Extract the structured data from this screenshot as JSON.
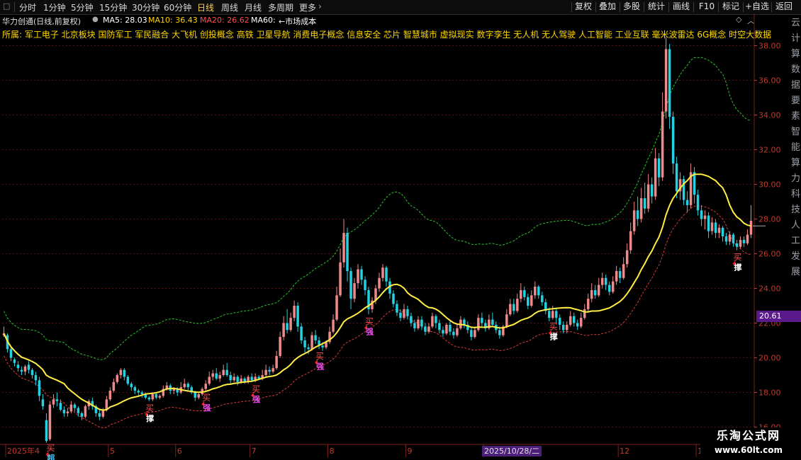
{
  "toolbar": {
    "tabs": [
      "分时",
      "1分钟",
      "5分钟",
      "15分钟",
      "30分钟",
      "60分钟",
      "日线",
      "周线",
      "月线",
      "多周期",
      "更多"
    ],
    "active_tab": "日线",
    "right_buttons": [
      "复权",
      "叠加",
      "多股",
      "统计",
      "画线",
      "F10",
      "标记",
      "+自选",
      "返回"
    ]
  },
  "info": {
    "stock": "华力创通(日线,前复权)",
    "ma5_label": "MA5: 28.03",
    "ma10_label": "MA10: 36.43",
    "ma20_label": "MA20: 26.62",
    "ma60_label": "MA60:",
    "market_cost": "←市场成本",
    "colors": {
      "ma5": "#ffffff",
      "ma10": "#ffd000",
      "ma20": "#ff4d4d",
      "ma60": "#ffffff",
      "cost": "#ffffff"
    }
  },
  "concepts": "所属: 军工电子 北京板块 国防军工 军民融合 大飞机 创投概念 高铁 卫星导航 消费电子概念 信息安全 芯片 智慧城市 虚拟现实 数字孪生 无人机 无人驾驶 人工智能 工业互联 毫米波雷达 6G概念 时空大数据",
  "price_tag": "20.61",
  "right_side_text": "云计算数据要素智能算力科技人工发展",
  "watermark": {
    "line1": "乐淘公式网",
    "line2": "www.60lt.com"
  },
  "x_selected_label": "2025/10/28/二",
  "chart_data": {
    "type": "candlestick",
    "y_axis": {
      "min": 15,
      "max": 39,
      "ticks": [
        16.0,
        18.0,
        20.0,
        22.0,
        24.0,
        26.0,
        28.0,
        30.0,
        32.0,
        34.0,
        36.0,
        38.0
      ]
    },
    "x_axis_labels": [
      {
        "label": "2025年4",
        "i": 1
      },
      {
        "label": "5",
        "i": 30
      },
      {
        "label": "6",
        "i": 49
      },
      {
        "label": "7",
        "i": 70
      },
      {
        "label": "8",
        "i": 92
      },
      {
        "label": "9",
        "i": 114
      },
      {
        "label": "10",
        "i": 136
      },
      {
        "label": "12",
        "i": 174
      },
      {
        "label": "1",
        "i": 196
      }
    ],
    "bars": [
      [
        21.3,
        21.4,
        21.8,
        21.2
      ],
      [
        21.3,
        20.5,
        21.4,
        20.3
      ],
      [
        20.5,
        20.0,
        20.6,
        19.8
      ],
      [
        19.9,
        19.7,
        20.0,
        19.5
      ],
      [
        19.6,
        19.4,
        19.8,
        19.2
      ],
      [
        19.3,
        19.2,
        19.5,
        19.0
      ],
      [
        19.2,
        19.5,
        19.6,
        19.0
      ],
      [
        19.6,
        19.3,
        19.8,
        19.1
      ],
      [
        19.3,
        19.0,
        19.4,
        18.8
      ],
      [
        19.0,
        18.7,
        19.2,
        18.4
      ],
      [
        18.7,
        17.8,
        18.9,
        17.5
      ],
      [
        17.6,
        17.2,
        17.9,
        17.0
      ],
      [
        16.4,
        15.2,
        16.8,
        15.1
      ],
      [
        15.3,
        17.3,
        17.5,
        15.2
      ],
      [
        17.3,
        17.6,
        17.9,
        17.1
      ],
      [
        17.6,
        17.5,
        18.0,
        17.2
      ],
      [
        17.4,
        17.0,
        17.6,
        16.9
      ],
      [
        17.0,
        16.8,
        17.2,
        16.6
      ],
      [
        16.8,
        16.9,
        17.1,
        16.6
      ],
      [
        16.9,
        17.3,
        17.5,
        16.8
      ],
      [
        17.3,
        17.1,
        17.4,
        16.9
      ],
      [
        17.1,
        16.8,
        17.2,
        16.6
      ],
      [
        16.8,
        16.6,
        16.9,
        16.4
      ],
      [
        16.6,
        17.2,
        17.3,
        16.5
      ],
      [
        17.2,
        17.5,
        17.6,
        17.0
      ],
      [
        17.5,
        17.2,
        17.7,
        17.0
      ],
      [
        17.2,
        16.8,
        17.3,
        16.6
      ],
      [
        16.8,
        16.6,
        17.0,
        16.4
      ],
      [
        16.6,
        17.0,
        17.1,
        16.5
      ],
      [
        17.0,
        17.6,
        17.8,
        16.9
      ],
      [
        17.6,
        18.1,
        18.3,
        17.5
      ],
      [
        18.1,
        18.6,
        18.8,
        18.0
      ],
      [
        18.6,
        19.0,
        19.1,
        18.5
      ],
      [
        19.0,
        19.3,
        19.4,
        18.8
      ],
      [
        19.3,
        18.9,
        19.4,
        18.7
      ],
      [
        18.9,
        18.5,
        19.0,
        18.4
      ],
      [
        18.5,
        18.3,
        18.6,
        18.1
      ],
      [
        18.3,
        18.1,
        18.4,
        17.9
      ],
      [
        18.1,
        18.0,
        18.2,
        17.8
      ],
      [
        18.0,
        17.9,
        18.1,
        17.7
      ],
      [
        17.9,
        17.7,
        18.0,
        17.6
      ],
      [
        17.7,
        17.6,
        17.8,
        17.5
      ],
      [
        17.6,
        17.9,
        18.0,
        17.5
      ],
      [
        17.9,
        17.7,
        18.0,
        17.6
      ],
      [
        17.7,
        17.8,
        17.9,
        17.6
      ],
      [
        17.8,
        18.2,
        18.4,
        17.7
      ],
      [
        18.2,
        18.4,
        18.6,
        18.1
      ],
      [
        18.4,
        18.1,
        18.5,
        17.9
      ],
      [
        18.1,
        18.2,
        18.3,
        17.9
      ],
      [
        18.2,
        18.0,
        18.3,
        17.8
      ],
      [
        18.0,
        18.3,
        18.6,
        17.9
      ],
      [
        18.3,
        18.5,
        18.8,
        18.2
      ],
      [
        18.5,
        18.3,
        18.6,
        18.1
      ],
      [
        18.3,
        18.0,
        18.4,
        17.9
      ],
      [
        18.0,
        17.7,
        18.1,
        17.5
      ],
      [
        17.7,
        17.9,
        18.0,
        17.6
      ],
      [
        17.9,
        18.2,
        18.3,
        17.8
      ],
      [
        18.2,
        18.5,
        18.7,
        18.1
      ],
      [
        18.5,
        18.9,
        19.2,
        18.4
      ],
      [
        18.9,
        19.1,
        19.3,
        18.7
      ],
      [
        19.1,
        18.8,
        19.4,
        18.7
      ],
      [
        18.8,
        19.0,
        19.2,
        18.6
      ],
      [
        19.0,
        19.3,
        19.6,
        18.9
      ],
      [
        19.3,
        19.0,
        19.7,
        18.9
      ],
      [
        19.0,
        18.7,
        19.2,
        18.5
      ],
      [
        18.7,
        18.9,
        19.1,
        18.6
      ],
      [
        18.9,
        18.6,
        19.0,
        18.4
      ],
      [
        18.6,
        18.8,
        19.0,
        18.5
      ],
      [
        18.8,
        18.6,
        18.9,
        18.5
      ],
      [
        18.6,
        18.9,
        19.0,
        18.5
      ],
      [
        18.9,
        18.7,
        19.1,
        18.6
      ],
      [
        18.7,
        18.9,
        19.1,
        18.6
      ],
      [
        18.9,
        18.8,
        19.0,
        18.7
      ],
      [
        18.8,
        19.0,
        19.3,
        18.7
      ],
      [
        19.0,
        19.3,
        19.6,
        18.9
      ],
      [
        19.3,
        19.2,
        19.5,
        19.0
      ],
      [
        19.2,
        19.4,
        19.6,
        19.1
      ],
      [
        19.4,
        20.1,
        20.4,
        19.3
      ],
      [
        20.1,
        21.2,
        21.5,
        20.0
      ],
      [
        21.2,
        22.0,
        22.4,
        21.0
      ],
      [
        22.0,
        21.6,
        22.8,
        21.4
      ],
      [
        21.6,
        22.3,
        22.6,
        21.5
      ],
      [
        22.3,
        23.0,
        23.3,
        22.1
      ],
      [
        23.0,
        21.8,
        23.2,
        21.5
      ],
      [
        21.8,
        21.0,
        22.0,
        20.8
      ],
      [
        21.0,
        20.6,
        21.2,
        20.3
      ],
      [
        20.6,
        20.5,
        20.8,
        20.2
      ],
      [
        20.5,
        21.3,
        21.5,
        20.4
      ],
      [
        21.3,
        21.0,
        21.6,
        20.8
      ],
      [
        21.0,
        20.7,
        21.2,
        20.5
      ],
      [
        20.7,
        20.6,
        20.9,
        20.4
      ],
      [
        20.6,
        20.9,
        21.0,
        20.5
      ],
      [
        20.9,
        21.5,
        21.8,
        20.8
      ],
      [
        21.5,
        22.2,
        22.5,
        21.4
      ],
      [
        22.2,
        23.6,
        24.1,
        22.1
      ],
      [
        23.6,
        25.5,
        26.3,
        23.5
      ],
      [
        25.5,
        27.2,
        28.0,
        25.2
      ],
      [
        27.2,
        25.0,
        27.5,
        24.4
      ],
      [
        25.0,
        23.4,
        25.2,
        22.8
      ],
      [
        23.4,
        24.3,
        24.6,
        23.2
      ],
      [
        24.3,
        25.1,
        25.4,
        24.0
      ],
      [
        25.1,
        24.5,
        25.3,
        24.2
      ],
      [
        24.5,
        23.9,
        24.7,
        23.6
      ],
      [
        23.9,
        22.8,
        24.1,
        22.5
      ],
      [
        22.8,
        23.3,
        23.5,
        22.6
      ],
      [
        23.3,
        24.0,
        24.2,
        23.1
      ],
      [
        24.0,
        24.6,
        24.9,
        23.8
      ],
      [
        24.6,
        25.2,
        25.4,
        24.4
      ],
      [
        25.2,
        24.4,
        25.3,
        24.1
      ],
      [
        24.4,
        23.7,
        24.6,
        23.4
      ],
      [
        23.7,
        23.1,
        23.9,
        22.9
      ],
      [
        23.1,
        22.6,
        23.3,
        22.4
      ],
      [
        22.6,
        22.3,
        22.8,
        22.1
      ],
      [
        22.3,
        22.8,
        23.1,
        22.2
      ],
      [
        22.8,
        22.4,
        23.0,
        22.2
      ],
      [
        22.4,
        22.0,
        22.6,
        21.8
      ],
      [
        22.0,
        21.7,
        22.2,
        21.5
      ],
      [
        21.7,
        22.2,
        22.4,
        21.6
      ],
      [
        22.2,
        21.8,
        22.4,
        21.6
      ],
      [
        21.8,
        21.5,
        22.0,
        21.3
      ],
      [
        21.5,
        21.8,
        22.0,
        21.4
      ],
      [
        21.8,
        22.4,
        22.6,
        21.7
      ],
      [
        22.4,
        22.0,
        22.5,
        21.7
      ],
      [
        22.0,
        21.6,
        22.2,
        21.4
      ],
      [
        21.6,
        21.4,
        21.8,
        21.2
      ],
      [
        21.4,
        21.9,
        22.0,
        21.3
      ],
      [
        21.9,
        21.5,
        22.1,
        21.3
      ],
      [
        21.5,
        21.3,
        21.7,
        21.1
      ],
      [
        21.3,
        21.7,
        21.9,
        21.2
      ],
      [
        21.7,
        22.2,
        22.4,
        21.6
      ],
      [
        22.2,
        21.9,
        22.3,
        21.7
      ],
      [
        21.9,
        21.6,
        22.1,
        21.4
      ],
      [
        21.6,
        21.2,
        21.8,
        21.0
      ],
      [
        21.2,
        21.6,
        21.8,
        21.1
      ],
      [
        21.6,
        22.3,
        22.5,
        21.5
      ],
      [
        22.3,
        22.0,
        22.6,
        21.8
      ],
      [
        22.0,
        21.7,
        22.2,
        21.5
      ],
      [
        21.7,
        22.2,
        22.5,
        21.6
      ],
      [
        22.2,
        21.9,
        22.6,
        21.8
      ],
      [
        21.9,
        21.6,
        22.1,
        21.4
      ],
      [
        21.6,
        21.3,
        21.8,
        21.1
      ],
      [
        21.3,
        21.8,
        21.9,
        21.2
      ],
      [
        21.8,
        22.5,
        22.8,
        21.7
      ],
      [
        22.5,
        23.1,
        23.4,
        22.4
      ],
      [
        23.1,
        22.7,
        23.4,
        22.5
      ],
      [
        22.7,
        23.4,
        23.7,
        22.6
      ],
      [
        23.4,
        23.9,
        24.3,
        23.2
      ],
      [
        23.9,
        23.5,
        24.1,
        23.3
      ],
      [
        23.5,
        23.0,
        23.7,
        22.8
      ],
      [
        23.0,
        23.6,
        23.9,
        22.9
      ],
      [
        23.6,
        24.1,
        24.4,
        23.4
      ],
      [
        24.1,
        23.6,
        24.2,
        23.4
      ],
      [
        23.6,
        23.2,
        23.8,
        23.0
      ],
      [
        23.2,
        22.7,
        23.4,
        22.5
      ],
      [
        22.7,
        22.3,
        22.9,
        22.1
      ],
      [
        22.3,
        22.7,
        23.0,
        22.2
      ],
      [
        22.7,
        22.3,
        22.9,
        22.0
      ],
      [
        22.3,
        21.9,
        22.5,
        21.6
      ],
      [
        21.9,
        21.6,
        22.1,
        21.4
      ],
      [
        21.6,
        21.9,
        22.1,
        21.4
      ],
      [
        21.9,
        22.4,
        22.7,
        21.8
      ],
      [
        22.4,
        22.0,
        22.6,
        21.8
      ],
      [
        22.0,
        21.8,
        22.2,
        21.6
      ],
      [
        21.8,
        22.3,
        22.6,
        21.7
      ],
      [
        22.3,
        22.8,
        23.1,
        22.2
      ],
      [
        22.8,
        23.4,
        23.7,
        22.6
      ],
      [
        23.4,
        23.9,
        24.3,
        23.2
      ],
      [
        23.9,
        23.6,
        24.2,
        23.4
      ],
      [
        23.6,
        24.2,
        24.6,
        23.5
      ],
      [
        24.2,
        24.6,
        24.9,
        24.0
      ],
      [
        24.6,
        24.2,
        24.8,
        23.9
      ],
      [
        24.2,
        23.8,
        24.4,
        23.6
      ],
      [
        23.8,
        24.4,
        24.7,
        23.7
      ],
      [
        24.4,
        25.0,
        25.3,
        24.2
      ],
      [
        25.0,
        24.6,
        25.2,
        24.3
      ],
      [
        24.6,
        25.4,
        25.8,
        24.5
      ],
      [
        25.4,
        26.2,
        26.6,
        25.2
      ],
      [
        26.2,
        27.3,
        27.8,
        26.0
      ],
      [
        27.3,
        28.5,
        29.0,
        27.1
      ],
      [
        28.5,
        28.0,
        29.3,
        27.6
      ],
      [
        28.0,
        29.2,
        29.8,
        27.8
      ],
      [
        29.2,
        28.6,
        30.1,
        28.3
      ],
      [
        28.6,
        30.0,
        30.6,
        28.4
      ],
      [
        30.0,
        29.3,
        30.4,
        28.9
      ],
      [
        29.3,
        31.5,
        32.1,
        29.1
      ],
      [
        31.5,
        30.4,
        31.8,
        29.9
      ],
      [
        30.4,
        34.2,
        35.3,
        30.2
      ],
      [
        34.2,
        37.8,
        38.5,
        33.8
      ],
      [
        37.8,
        33.9,
        38.1,
        33.2
      ],
      [
        33.9,
        31.2,
        34.2,
        30.6
      ],
      [
        31.2,
        29.6,
        31.6,
        29.2
      ],
      [
        29.6,
        30.3,
        30.7,
        29.1
      ],
      [
        30.3,
        29.1,
        30.5,
        28.8
      ],
      [
        29.1,
        28.8,
        29.6,
        28.4
      ],
      [
        28.8,
        30.7,
        31.2,
        28.6
      ],
      [
        30.7,
        29.4,
        31.0,
        28.9
      ],
      [
        29.4,
        28.5,
        29.7,
        28.2
      ],
      [
        28.5,
        28.0,
        28.8,
        27.6
      ],
      [
        28.0,
        28.2,
        28.5,
        27.4
      ],
      [
        28.2,
        27.3,
        28.4,
        26.9
      ],
      [
        27.3,
        27.8,
        28.1,
        27.1
      ],
      [
        27.8,
        27.2,
        28.0,
        26.9
      ],
      [
        27.2,
        27.5,
        27.7,
        26.9
      ],
      [
        27.5,
        27.0,
        27.6,
        26.7
      ],
      [
        27.0,
        26.7,
        27.2,
        26.5
      ],
      [
        26.7,
        27.1,
        27.3,
        26.5
      ],
      [
        27.1,
        26.6,
        27.2,
        26.4
      ],
      [
        26.6,
        26.4,
        26.8,
        26.2
      ],
      [
        26.4,
        26.8,
        27.0,
        26.3
      ],
      [
        26.8,
        26.6,
        27.0,
        26.4
      ],
      [
        26.6,
        27.1,
        27.4,
        26.5
      ],
      [
        27.1,
        27.9,
        28.8,
        26.9
      ]
    ],
    "signals": [
      {
        "i": 13,
        "text": "买",
        "sub": "超"
      },
      {
        "i": 41,
        "text": "买",
        "sub": "撑"
      },
      {
        "i": 57,
        "text": "买",
        "sub": "强"
      },
      {
        "i": 71,
        "text": "买",
        "sub": "强"
      },
      {
        "i": 89,
        "text": "买",
        "sub": "强"
      },
      {
        "i": 103,
        "text": "买",
        "sub": "强"
      },
      {
        "i": 155,
        "text": "买",
        "sub": "撑"
      },
      {
        "i": 207,
        "text": "买",
        "sub": "撑"
      }
    ],
    "lines": {
      "market_cost_color": "#ffee44",
      "upper_band_color": "#2fbf2f",
      "lower_band_color": "#d63a3a"
    },
    "up_color": "#f08a8a",
    "down_color": "#25d0e0"
  }
}
